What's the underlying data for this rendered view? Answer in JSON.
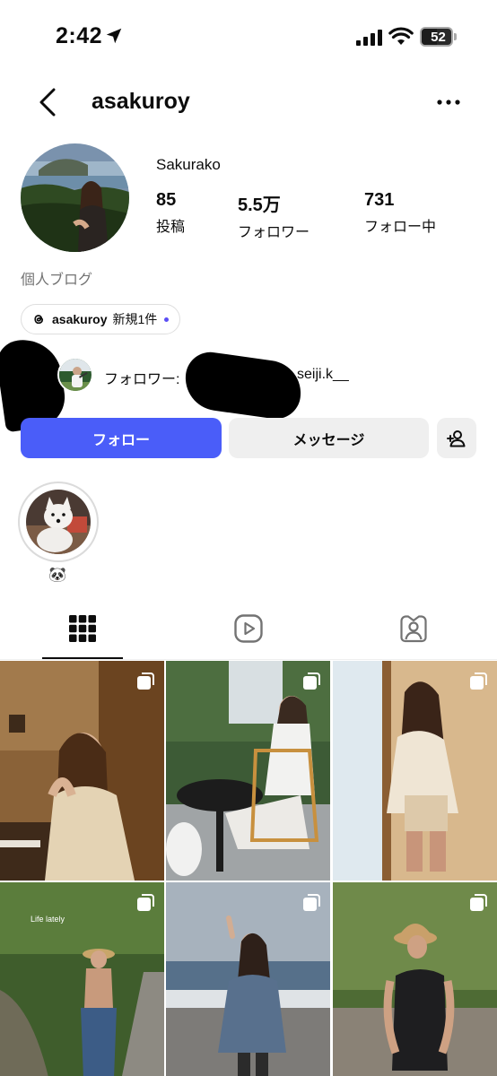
{
  "status_bar": {
    "time": "2:42",
    "battery": "52",
    "battery_level": 0.52
  },
  "header": {
    "username": "asakuroy",
    "back_icon": "chevron-left-icon",
    "more_icon": "more-horizontal-icon"
  },
  "profile": {
    "display_name": "Sakurako",
    "stats": [
      {
        "value": "85",
        "label": "投稿"
      },
      {
        "value": "5.5万",
        "label": "フォロワー"
      },
      {
        "value": "731",
        "label": "フォロー中"
      }
    ],
    "category": "個人ブログ",
    "threads": {
      "name": "asakuroy",
      "badge": "新規1件"
    },
    "followed_by": {
      "prefix": "フォロワー: ",
      "name": "seiji.k__"
    }
  },
  "buttons": {
    "follow": "フォロー",
    "message": "メッセージ",
    "add_user_icon": "person-add-icon"
  },
  "highlights": [
    {
      "label": "🐼"
    }
  ],
  "tabs": [
    {
      "name": "posts",
      "icon": "grid-icon",
      "active": true
    },
    {
      "name": "reels",
      "icon": "reels-icon",
      "active": false
    },
    {
      "name": "tagged",
      "icon": "tagged-person-icon",
      "active": false
    }
  ],
  "grid": [
    {
      "multi": true
    },
    {
      "multi": true
    },
    {
      "multi": true
    },
    {
      "multi": true,
      "caption": "Life lately"
    },
    {
      "multi": true
    },
    {
      "multi": true
    }
  ],
  "colors": {
    "follow_button": "#4a5df9",
    "secondary_button": "#efefef",
    "threads_dot": "#5b4ef5"
  }
}
